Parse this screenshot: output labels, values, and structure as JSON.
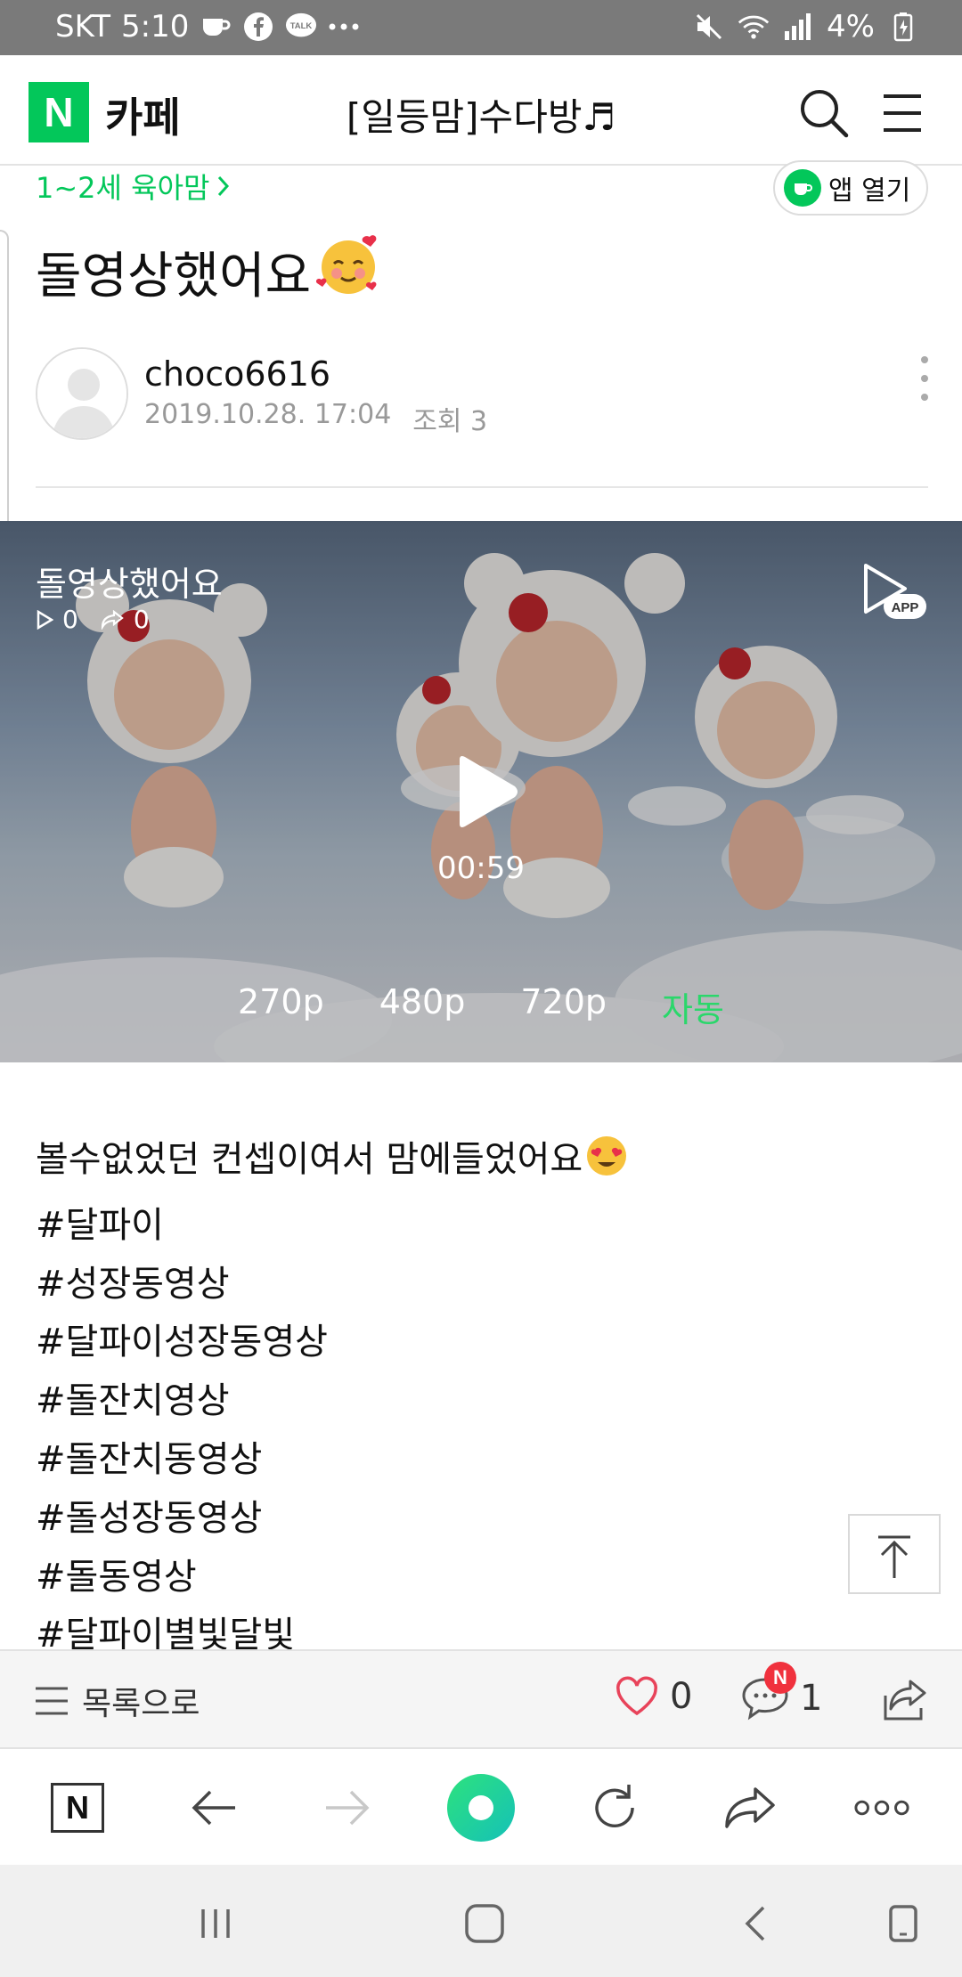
{
  "status_bar": {
    "carrier": "SKT",
    "time": "5:10",
    "battery": "4%",
    "notification_icons": [
      "coffee-icon",
      "facebook-icon",
      "kakaotalk-icon",
      "more-dots-icon"
    ],
    "talk_badge": "TALK",
    "system_icons": [
      "mute-icon",
      "wifi-icon",
      "signal-icon",
      "battery-icon"
    ]
  },
  "header": {
    "logo": "N",
    "service_label": "카페",
    "cafe_name": "[일등맘]수다방♬"
  },
  "article": {
    "category": "1~2세 육아맘",
    "app_open_label": "앱 열기",
    "title": "돌영상했어요",
    "title_emoji": "🥰",
    "author": "choco6616",
    "date": "2019.10.28. 17:04",
    "views": "조회 3"
  },
  "video": {
    "title": "돌영상했어요",
    "play_count": "0",
    "share_count": "0",
    "app_badge": "APP",
    "duration": "00:59",
    "qualities": [
      "270p",
      "480p",
      "720p",
      "자동"
    ],
    "active_quality": "자동"
  },
  "body": {
    "intro": " 볼수없었던 컨셉이여서 맘에들었어요",
    "intro_emoji": "😍",
    "tags": [
      "#달파이",
      "#성장동영상",
      "#달파이성장동영상",
      "#돌잔치영상",
      "#돌잔치동영상",
      "#돌성장동영상",
      "#돌동영상",
      "#달파이별빛달빛"
    ]
  },
  "actions": {
    "list_label": "목록으로",
    "likes": "0",
    "comments": "1",
    "comment_badge": "N"
  },
  "colors": {
    "brand_green": "#03c75a",
    "status_bar": "#7a7a7a",
    "badge_red": "#f0313d",
    "heart_red": "#e8435a"
  }
}
